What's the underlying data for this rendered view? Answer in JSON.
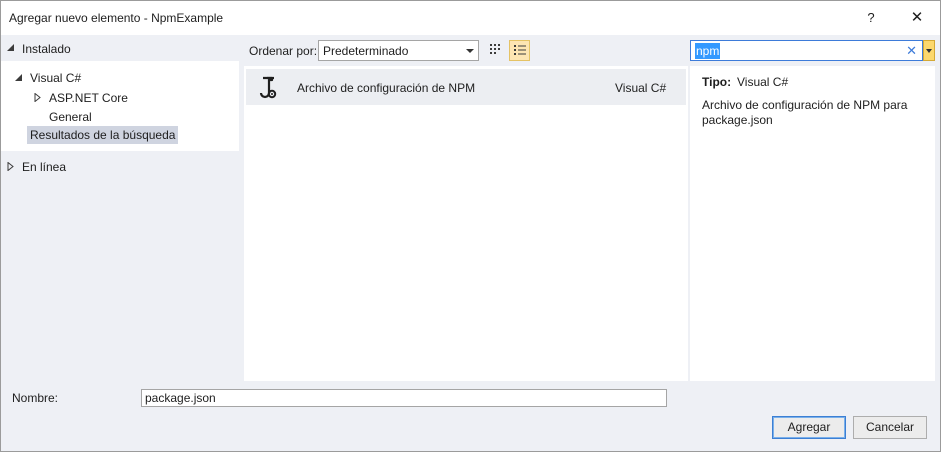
{
  "window": {
    "title": "Agregar nuevo elemento - NpmExample",
    "help_label": "?",
    "close_label": "✕"
  },
  "sidebar": {
    "installed_label": "Instalado",
    "tree": [
      {
        "label": "Visual C#",
        "expanded": true
      },
      {
        "label": "ASP.NET Core",
        "expanded": false
      },
      {
        "label": "General"
      },
      {
        "label": "Resultados de la búsqueda",
        "selected": true
      }
    ],
    "online_label": "En línea"
  },
  "toolbar": {
    "sort_label": "Ordenar por:",
    "sort_value": "Predeterminado",
    "view_mode": "list"
  },
  "search": {
    "value": "npm",
    "clear_label": "✕"
  },
  "results": [
    {
      "name": "Archivo de configuración de NPM",
      "language": "Visual C#",
      "icon": "npm-config-icon"
    }
  ],
  "detail": {
    "type_label": "Tipo:",
    "type_value": "Visual C#",
    "description": "Archivo de configuración de NPM para package.json"
  },
  "footer": {
    "name_label": "Nombre:",
    "name_value": "package.json",
    "add_label": "Agregar",
    "cancel_label": "Cancelar"
  },
  "colors": {
    "accent": "#3d7bd9",
    "selection": "#3399ff",
    "panel_bg": "#eef0f5"
  }
}
